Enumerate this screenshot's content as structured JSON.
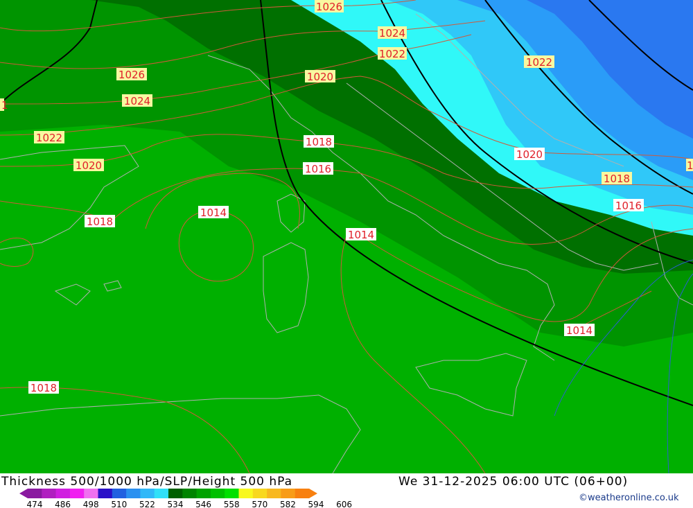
{
  "title": "Thickness 500/1000 hPa/SLP/Height 500 hPa",
  "valid_time": "We 31-12-2025 06:00 UTC (06+00)",
  "credit": "©weatheronline.co.uk",
  "legend": {
    "ticks": [
      "474",
      "486",
      "498",
      "510",
      "522",
      "534",
      "546",
      "558",
      "570",
      "582",
      "594",
      "606"
    ],
    "colors": [
      "#8a1aa0",
      "#b020c0",
      "#d020e0",
      "#f020f0",
      "#f070f0",
      "#2a10c8",
      "#2060e0",
      "#2a90f0",
      "#30b8f8",
      "#30e0f8",
      "#006000",
      "#008400",
      "#00a200",
      "#00c000",
      "#00e000",
      "#f8f820",
      "#f8d820",
      "#f8b820",
      "#f89c18",
      "#f88010"
    ]
  },
  "pressure_labels": [
    {
      "text": "1026",
      "style": "yellow"
    },
    {
      "text": "1024",
      "style": "yellow"
    },
    {
      "text": "1022",
      "style": "yellow"
    },
    {
      "text": "1026",
      "style": "yellow"
    },
    {
      "text": "1024",
      "style": "yellow"
    },
    {
      "text": "1020",
      "style": "yellow"
    },
    {
      "text": "1022",
      "style": "yellow"
    },
    {
      "text": "1020",
      "style": "yellow"
    },
    {
      "text": "1018",
      "style": "white"
    },
    {
      "text": "1016",
      "style": "white"
    },
    {
      "text": "1022",
      "style": "yellow"
    },
    {
      "text": "1020",
      "style": "white"
    },
    {
      "text": "1018",
      "style": "yellow"
    },
    {
      "text": "1016",
      "style": "white"
    },
    {
      "text": "1018",
      "style": "white"
    },
    {
      "text": "1014",
      "style": "white"
    },
    {
      "text": "1014",
      "style": "white"
    },
    {
      "text": "1014",
      "style": "white"
    },
    {
      "text": "1018",
      "style": "white"
    },
    {
      "text": "1",
      "style": "yellow"
    },
    {
      "text": "1",
      "style": "yellow"
    }
  ],
  "colors": {
    "green_light": "#00b000",
    "green_mid": "#009400",
    "green_dark": "#007000",
    "cyan": "#30f8f8",
    "sky": "#30c8f8",
    "blue": "#2a9cf8",
    "blue_deep": "#2a78f0",
    "isobar": "#d05a3a",
    "height_line": "#000000",
    "coast": "#b0b0b0",
    "label_yellow": "#f8f8a0",
    "label_white": "#ffffff",
    "label_text": "#e0202a"
  }
}
